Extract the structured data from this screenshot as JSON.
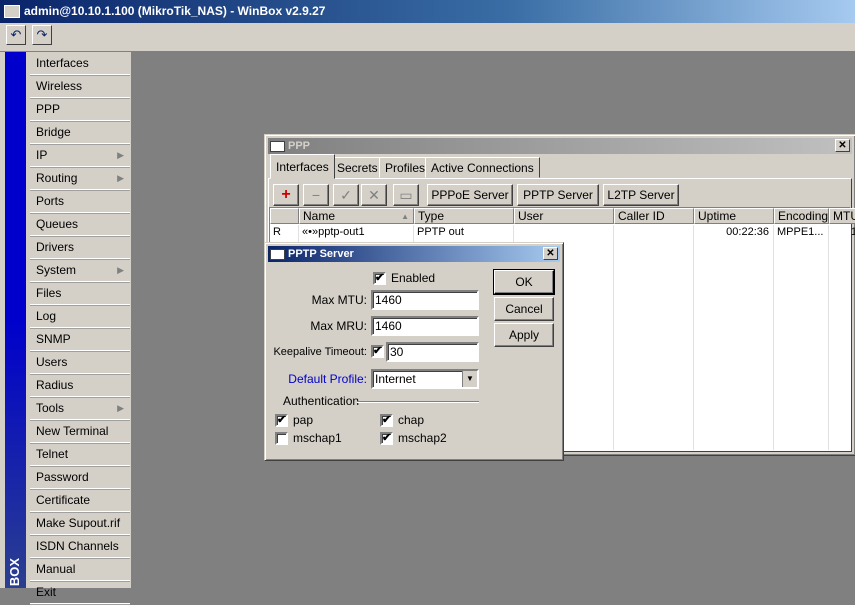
{
  "app": {
    "title": "admin@10.10.1.100 (MikroTik_NAS) - WinBox v2.9.27"
  },
  "toolbar": {
    "undo_icon": "undo-icon",
    "redo_icon": "redo-icon"
  },
  "sidebar": {
    "brand": "BOX",
    "items": [
      {
        "label": "Interfaces",
        "submenu": false
      },
      {
        "label": "Wireless",
        "submenu": false
      },
      {
        "label": "PPP",
        "submenu": false
      },
      {
        "label": "Bridge",
        "submenu": false
      },
      {
        "label": "IP",
        "submenu": true
      },
      {
        "label": "Routing",
        "submenu": true
      },
      {
        "label": "Ports",
        "submenu": false
      },
      {
        "label": "Queues",
        "submenu": false
      },
      {
        "label": "Drivers",
        "submenu": false
      },
      {
        "label": "System",
        "submenu": true
      },
      {
        "label": "Files",
        "submenu": false
      },
      {
        "label": "Log",
        "submenu": false
      },
      {
        "label": "SNMP",
        "submenu": false
      },
      {
        "label": "Users",
        "submenu": false
      },
      {
        "label": "Radius",
        "submenu": false
      },
      {
        "label": "Tools",
        "submenu": true
      },
      {
        "label": "New Terminal",
        "submenu": false
      },
      {
        "label": "Telnet",
        "submenu": false
      },
      {
        "label": "Password",
        "submenu": false
      },
      {
        "label": "Certificate",
        "submenu": false
      },
      {
        "label": "Make Supout.rif",
        "submenu": false
      },
      {
        "label": "ISDN Channels",
        "submenu": false
      },
      {
        "label": "Manual",
        "submenu": false
      },
      {
        "label": "Exit",
        "submenu": false
      }
    ]
  },
  "ppp": {
    "title": "PPP",
    "close": "✕",
    "tabs": [
      "Interfaces",
      "Secrets",
      "Profiles",
      "Active Connections"
    ],
    "buttons": {
      "add": "+",
      "remove": "−",
      "enable": "✓",
      "disable": "✕",
      "comment": "▭",
      "pppoe": "PPPoE Server",
      "pptp": "PPTP Server",
      "l2tp": "L2TP Server"
    },
    "columns": [
      "",
      "Name",
      "Type",
      "User",
      "Caller ID",
      "Uptime",
      "Encoding",
      "MTU"
    ],
    "rows": [
      {
        "flag": "R",
        "name": "«•»pptp-out1",
        "type": "PPTP out",
        "user": "",
        "caller_id": "",
        "uptime": "00:22:36",
        "encoding": "MPPE1...",
        "mtu": "1"
      }
    ]
  },
  "pptp": {
    "title": "PPTP Server",
    "close": "✕",
    "enabled_label": "Enabled",
    "enabled": true,
    "max_mtu_label": "Max MTU:",
    "max_mtu": "1460",
    "max_mru_label": "Max MRU:",
    "max_mru": "1460",
    "keepalive_label": "Keepalive Timeout:",
    "keepalive_checked": true,
    "keepalive": "30",
    "profile_label": "Default Profile:",
    "profile": "Internet",
    "auth_label": "Authentication",
    "auth": [
      {
        "label": "pap",
        "checked": true
      },
      {
        "label": "chap",
        "checked": true
      },
      {
        "label": "mschap1",
        "checked": false
      },
      {
        "label": "mschap2",
        "checked": true
      }
    ],
    "ok": "OK",
    "cancel": "Cancel",
    "apply": "Apply",
    "check_mark": "✔"
  }
}
